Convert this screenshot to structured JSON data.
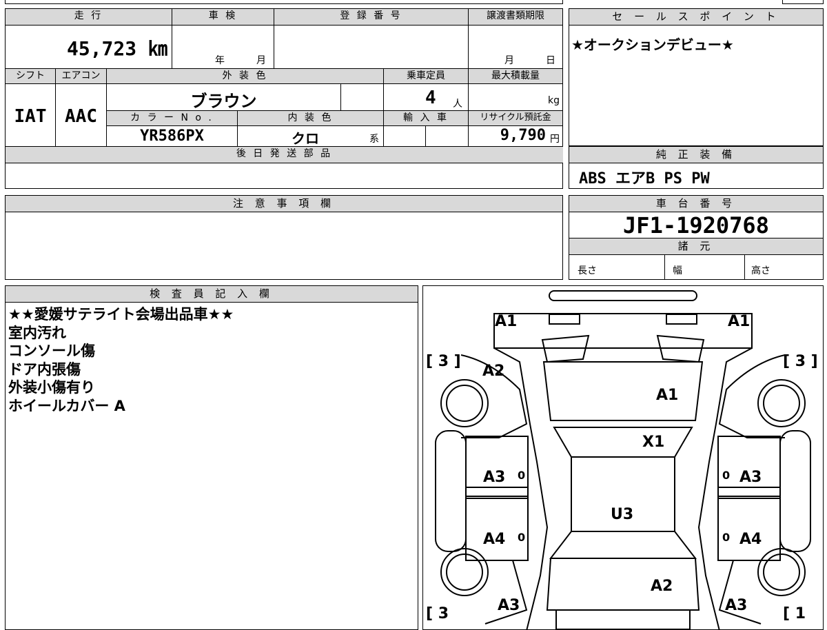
{
  "header": {
    "mileage_label": "走 行",
    "shaken_label": "車 検",
    "registration_label": "登 録 番 号",
    "transfer_deadline_label": "譲渡書類期限",
    "mileage_value": "45,723 ㎞",
    "year_unit": "年",
    "month_unit": "月",
    "day_unit": "日",
    "shift_label": "シフト",
    "aircon_label": "エアコン",
    "exterior_color_label": "外 装 色",
    "capacity_label": "乗車定員",
    "max_load_label": "最大積載量",
    "shift_value": "IAT",
    "aircon_value": "AAC",
    "exterior_color_value": "ブラウン",
    "capacity_value": "4",
    "capacity_unit": "人",
    "load_unit": "kg",
    "color_no_label": "カ ラ ー N o .",
    "interior_color_label": "内 装 色",
    "import_label": "輸 入 車",
    "recycle_label": "リサイクル預託金",
    "color_no_value": "YR586PX",
    "interior_color_value": "クロ",
    "interior_suffix": "系",
    "recycle_value": "9,790",
    "yen_unit": "円",
    "later_parts_label": "後 日 発 送 部 品"
  },
  "sales_point": {
    "label": "セ ー ル ス ポ イ ン ト",
    "text": "★オークションデビュー★"
  },
  "equipment": {
    "label": "純 正 装 備",
    "value": "ABS エアB PS PW"
  },
  "notes": {
    "label": "注 意 事 項 欄"
  },
  "chassis": {
    "label": "車 台 番 号",
    "value": "JF1-1920768",
    "specs_label": "諸 元",
    "length_label": "長さ",
    "width_label": "幅",
    "height_label": "高さ"
  },
  "inspector": {
    "label": "検 査 員 記 入 欄",
    "lines": [
      "★★愛媛サテライト会場出品車★★",
      "室内汚れ",
      "コンソール傷",
      "ドア内張傷",
      "外装小傷有り",
      "ホイールカバー A"
    ]
  },
  "diagram": {
    "marks": {
      "front_left": "A1",
      "front_right": "A1",
      "hood": "A1",
      "left_fender": "A2",
      "windshield": "X1",
      "front_left_door": "A3",
      "front_right_door": "A3",
      "roof": "U3",
      "rear_left_door": "A4",
      "rear_right_door": "A4",
      "trunk": "A2",
      "rear_left": "A3",
      "rear_right": "A3",
      "tire_front_left": "[ 3 ]",
      "tire_front_right": "[ 3 ]",
      "tire_rear_left": "[ 3",
      "tire_rear_right": "[ 1",
      "zero": "0"
    }
  }
}
